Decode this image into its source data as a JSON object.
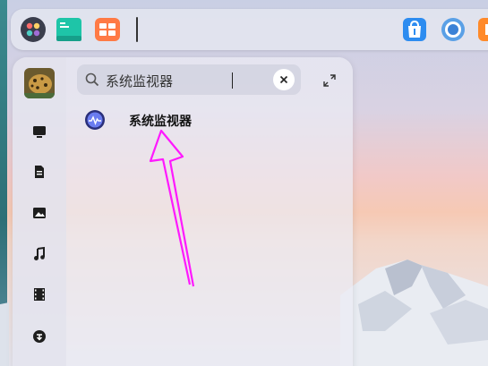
{
  "dock": {
    "items": [
      {
        "name": "launcher-icon"
      },
      {
        "name": "terminal-icon"
      },
      {
        "name": "multitask-view-icon"
      },
      {
        "name": "app-store-icon"
      },
      {
        "name": "browser-icon"
      },
      {
        "name": "app-icon-partial"
      }
    ]
  },
  "launcher": {
    "search": {
      "value": "系统监视器"
    },
    "sidebar": {
      "categories": [
        {
          "name": "all-apps-icon"
        },
        {
          "name": "documents-icon"
        },
        {
          "name": "pictures-icon"
        },
        {
          "name": "music-icon"
        },
        {
          "name": "videos-icon"
        },
        {
          "name": "downloads-icon"
        }
      ]
    },
    "results": [
      {
        "label": "系统监视器",
        "icon": "system-monitor-icon"
      }
    ]
  },
  "colors": {
    "accent": "#4a5fd6",
    "annotation": "#ff19ff"
  }
}
